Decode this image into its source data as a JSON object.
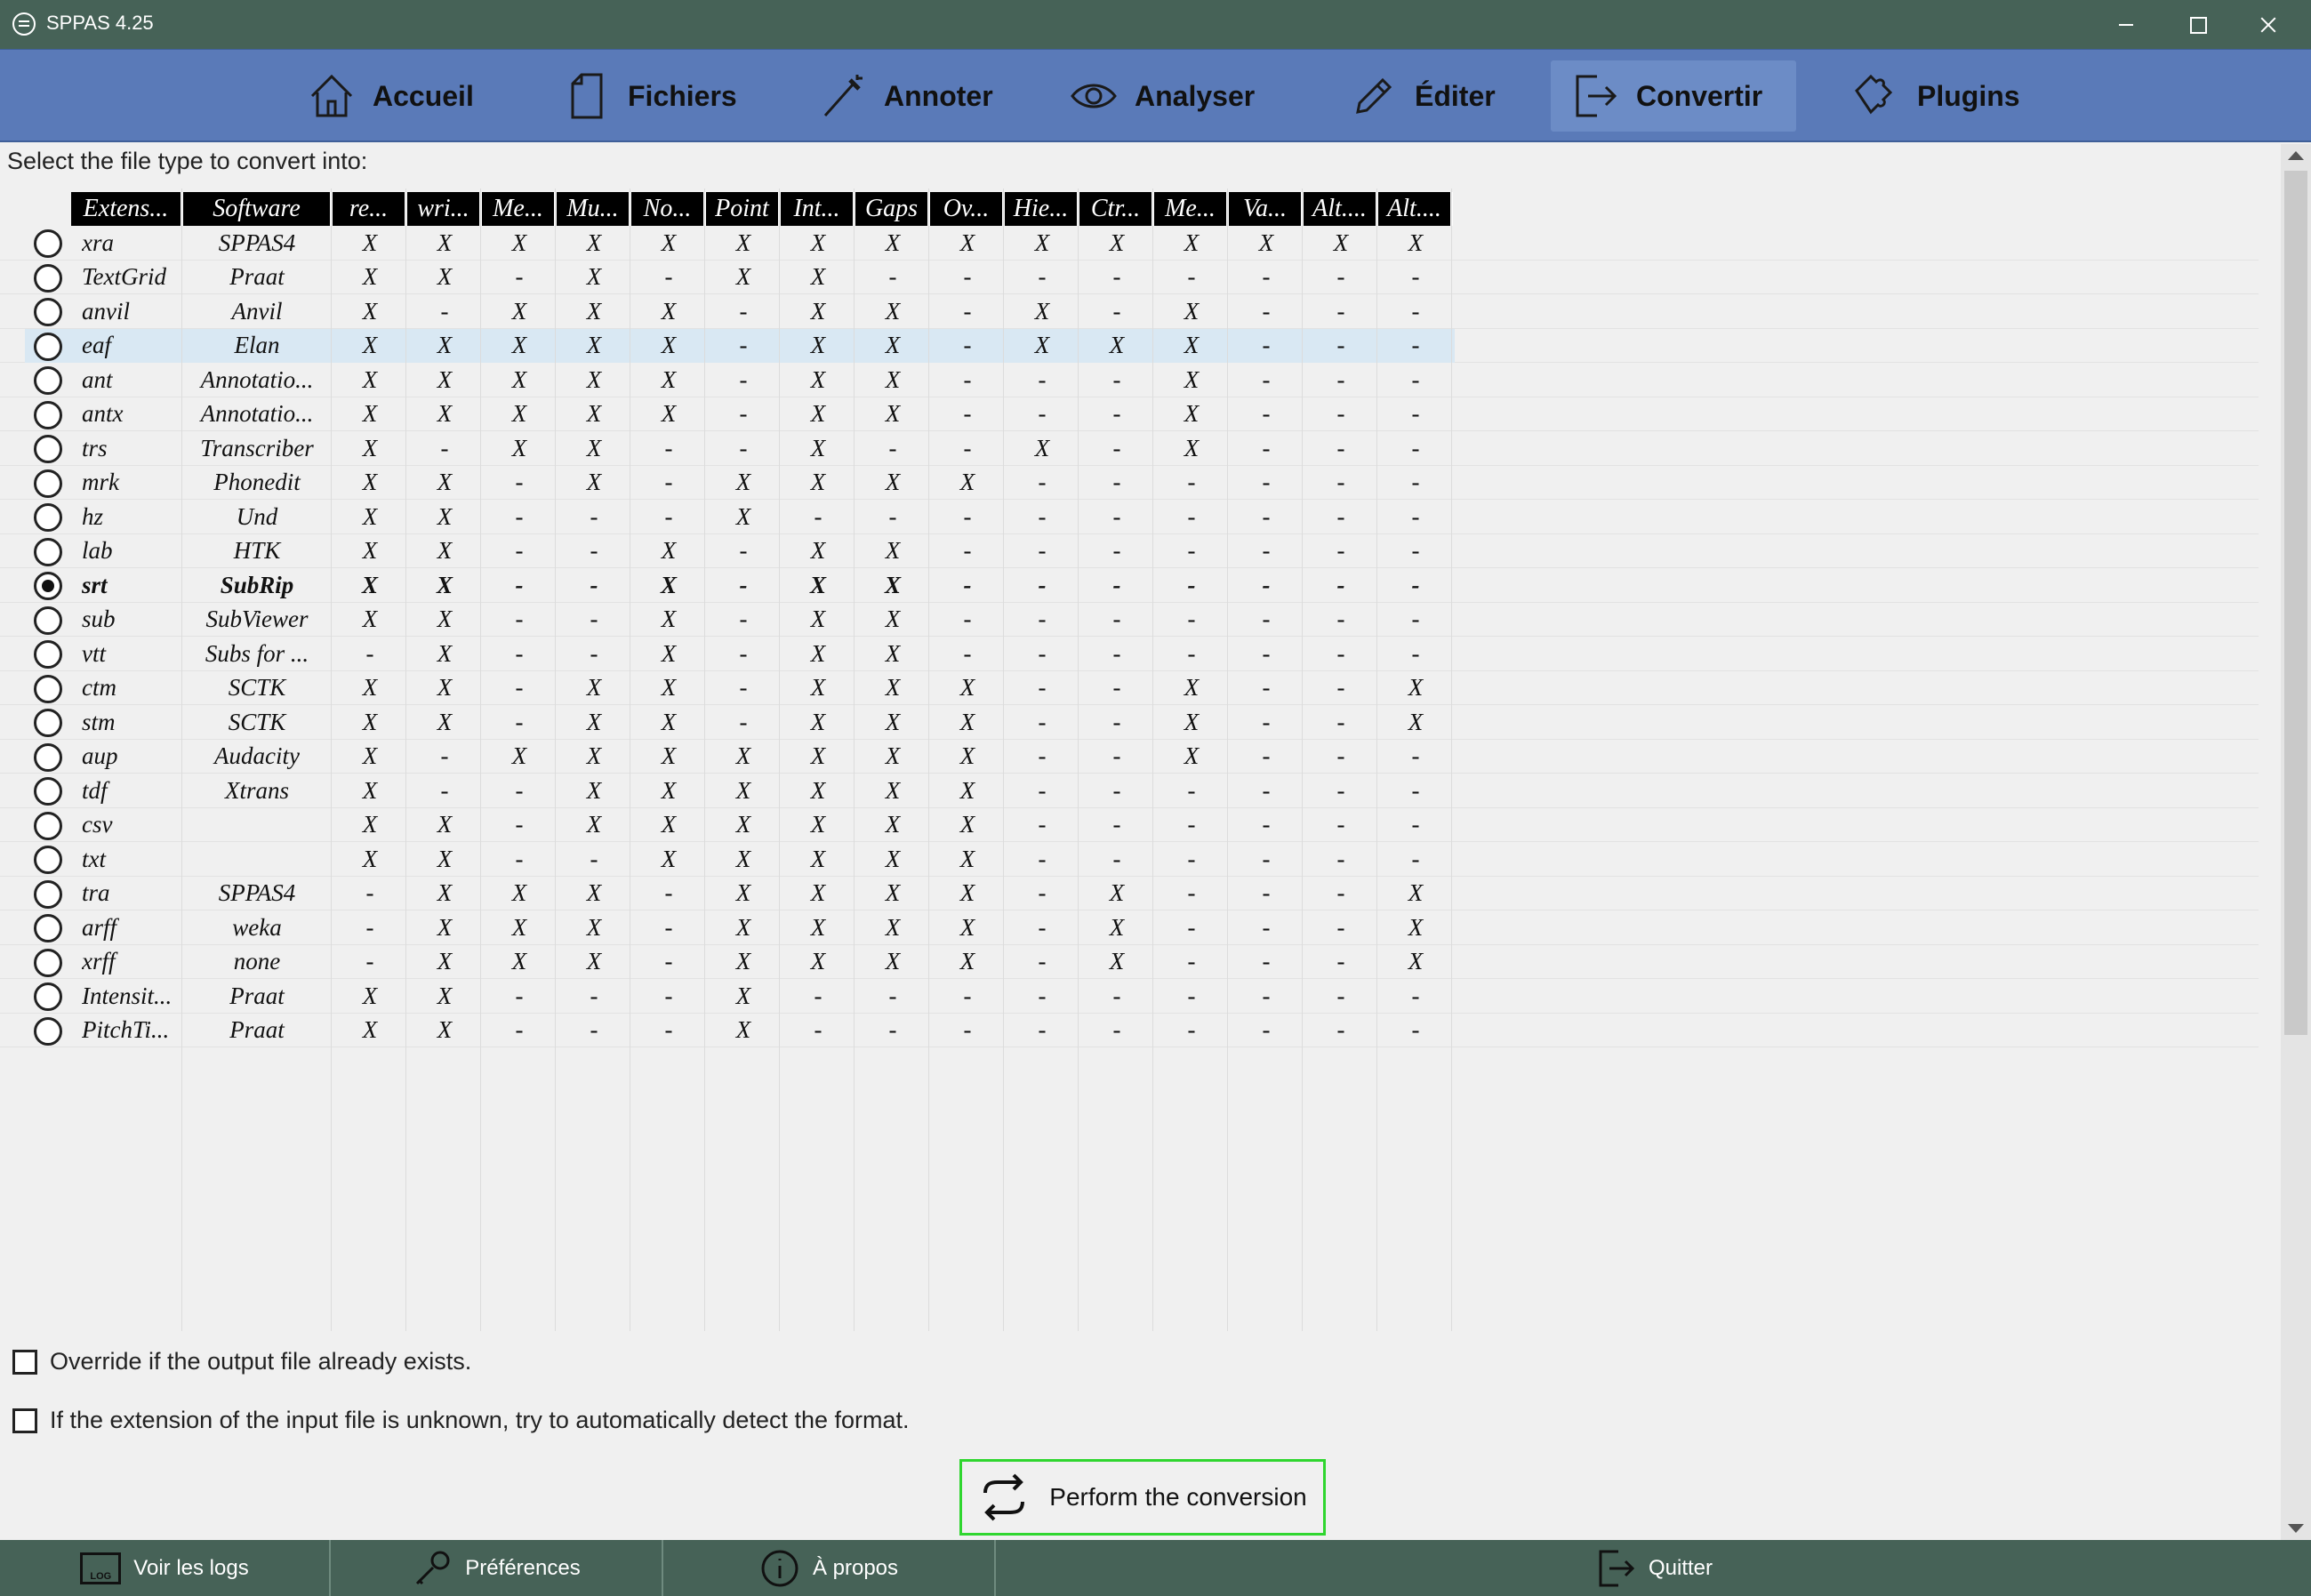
{
  "window": {
    "title": "SPPAS 4.25"
  },
  "nav": {
    "tabs": [
      {
        "label": "Accueil",
        "icon": "home-icon"
      },
      {
        "label": "Fichiers",
        "icon": "file-icon"
      },
      {
        "label": "Annoter",
        "icon": "wand-icon"
      },
      {
        "label": "Analyser",
        "icon": "eye-icon"
      },
      {
        "label": "Éditer",
        "icon": "pencil-icon"
      },
      {
        "label": "Convertir",
        "icon": "export-icon",
        "active": true
      },
      {
        "label": "Plugins",
        "icon": "puzzle-icon"
      }
    ]
  },
  "content": {
    "prompt": "Select the file type to convert into:"
  },
  "table": {
    "headers": [
      "Extens...",
      "Software",
      "re...",
      "wri...",
      "Me...",
      "Mu...",
      "No...",
      "Point",
      "Int...",
      "Gaps",
      "Ov...",
      "Hie...",
      "Ctr...",
      "Me...",
      "Va...",
      "Alt....",
      "Alt...."
    ],
    "selected_row": 10,
    "highlighted_row": 3,
    "rows": [
      {
        "ext": "xra",
        "software": "SPPAS4",
        "flags": [
          "X",
          "X",
          "X",
          "X",
          "X",
          "X",
          "X",
          "X",
          "X",
          "X",
          "X",
          "X",
          "X",
          "X",
          "X"
        ]
      },
      {
        "ext": "TextGrid",
        "software": "Praat",
        "flags": [
          "X",
          "X",
          "-",
          "X",
          "-",
          "X",
          "X",
          "-",
          "-",
          "-",
          "-",
          "-",
          "-",
          "-",
          "-"
        ]
      },
      {
        "ext": "anvil",
        "software": "Anvil",
        "flags": [
          "X",
          "-",
          "X",
          "X",
          "X",
          "-",
          "X",
          "X",
          "-",
          "X",
          "-",
          "X",
          "-",
          "-",
          "-"
        ]
      },
      {
        "ext": "eaf",
        "software": "Elan",
        "flags": [
          "X",
          "X",
          "X",
          "X",
          "X",
          "-",
          "X",
          "X",
          "-",
          "X",
          "X",
          "X",
          "-",
          "-",
          "-"
        ]
      },
      {
        "ext": "ant",
        "software": "Annotatio...",
        "flags": [
          "X",
          "X",
          "X",
          "X",
          "X",
          "-",
          "X",
          "X",
          "-",
          "-",
          "-",
          "X",
          "-",
          "-",
          "-"
        ]
      },
      {
        "ext": "antx",
        "software": "Annotatio...",
        "flags": [
          "X",
          "X",
          "X",
          "X",
          "X",
          "-",
          "X",
          "X",
          "-",
          "-",
          "-",
          "X",
          "-",
          "-",
          "-"
        ]
      },
      {
        "ext": "trs",
        "software": "Transcriber",
        "flags": [
          "X",
          "-",
          "X",
          "X",
          "-",
          "-",
          "X",
          "-",
          "-",
          "X",
          "-",
          "X",
          "-",
          "-",
          "-"
        ]
      },
      {
        "ext": "mrk",
        "software": "Phonedit",
        "flags": [
          "X",
          "X",
          "-",
          "X",
          "-",
          "X",
          "X",
          "X",
          "X",
          "-",
          "-",
          "-",
          "-",
          "-",
          "-"
        ]
      },
      {
        "ext": "hz",
        "software": "Und",
        "flags": [
          "X",
          "X",
          "-",
          "-",
          "-",
          "X",
          "-",
          "-",
          "-",
          "-",
          "-",
          "-",
          "-",
          "-",
          "-"
        ]
      },
      {
        "ext": "lab",
        "software": "HTK",
        "flags": [
          "X",
          "X",
          "-",
          "-",
          "X",
          "-",
          "X",
          "X",
          "-",
          "-",
          "-",
          "-",
          "-",
          "-",
          "-"
        ]
      },
      {
        "ext": "srt",
        "software": "SubRip",
        "flags": [
          "X",
          "X",
          "-",
          "-",
          "X",
          "-",
          "X",
          "X",
          "-",
          "-",
          "-",
          "-",
          "-",
          "-",
          "-"
        ]
      },
      {
        "ext": "sub",
        "software": "SubViewer",
        "flags": [
          "X",
          "X",
          "-",
          "-",
          "X",
          "-",
          "X",
          "X",
          "-",
          "-",
          "-",
          "-",
          "-",
          "-",
          "-"
        ]
      },
      {
        "ext": "vtt",
        "software": "Subs for ...",
        "flags": [
          "-",
          "X",
          "-",
          "-",
          "X",
          "-",
          "X",
          "X",
          "-",
          "-",
          "-",
          "-",
          "-",
          "-",
          "-"
        ]
      },
      {
        "ext": "ctm",
        "software": "SCTK",
        "flags": [
          "X",
          "X",
          "-",
          "X",
          "X",
          "-",
          "X",
          "X",
          "X",
          "-",
          "-",
          "X",
          "-",
          "-",
          "X"
        ]
      },
      {
        "ext": "stm",
        "software": "SCTK",
        "flags": [
          "X",
          "X",
          "-",
          "X",
          "X",
          "-",
          "X",
          "X",
          "X",
          "-",
          "-",
          "X",
          "-",
          "-",
          "X"
        ]
      },
      {
        "ext": "aup",
        "software": "Audacity",
        "flags": [
          "X",
          "-",
          "X",
          "X",
          "X",
          "X",
          "X",
          "X",
          "X",
          "-",
          "-",
          "X",
          "-",
          "-",
          "-"
        ]
      },
      {
        "ext": "tdf",
        "software": "Xtrans",
        "flags": [
          "X",
          "-",
          "-",
          "X",
          "X",
          "X",
          "X",
          "X",
          "X",
          "-",
          "-",
          "-",
          "-",
          "-",
          "-"
        ]
      },
      {
        "ext": "csv",
        "software": "",
        "flags": [
          "X",
          "X",
          "-",
          "X",
          "X",
          "X",
          "X",
          "X",
          "X",
          "-",
          "-",
          "-",
          "-",
          "-",
          "-"
        ]
      },
      {
        "ext": "txt",
        "software": "",
        "flags": [
          "X",
          "X",
          "-",
          "-",
          "X",
          "X",
          "X",
          "X",
          "X",
          "-",
          "-",
          "-",
          "-",
          "-",
          "-"
        ]
      },
      {
        "ext": "tra",
        "software": "SPPAS4",
        "flags": [
          "-",
          "X",
          "X",
          "X",
          "-",
          "X",
          "X",
          "X",
          "X",
          "-",
          "X",
          "-",
          "-",
          "-",
          "X"
        ]
      },
      {
        "ext": "arff",
        "software": "weka",
        "flags": [
          "-",
          "X",
          "X",
          "X",
          "-",
          "X",
          "X",
          "X",
          "X",
          "-",
          "X",
          "-",
          "-",
          "-",
          "X"
        ]
      },
      {
        "ext": "xrff",
        "software": "none",
        "flags": [
          "-",
          "X",
          "X",
          "X",
          "-",
          "X",
          "X",
          "X",
          "X",
          "-",
          "X",
          "-",
          "-",
          "-",
          "X"
        ]
      },
      {
        "ext": "Intensit...",
        "software": "Praat",
        "flags": [
          "X",
          "X",
          "-",
          "-",
          "-",
          "X",
          "-",
          "-",
          "-",
          "-",
          "-",
          "-",
          "-",
          "-",
          "-"
        ]
      },
      {
        "ext": "PitchTi...",
        "software": "Praat",
        "flags": [
          "X",
          "X",
          "-",
          "-",
          "-",
          "X",
          "-",
          "-",
          "-",
          "-",
          "-",
          "-",
          "-",
          "-",
          "-"
        ]
      }
    ]
  },
  "options": {
    "override_label": "Override if the output file already exists.",
    "override_checked": false,
    "autodetect_label": "If the extension of the input file is unknown, try to automatically detect the format.",
    "autodetect_checked": false
  },
  "actions": {
    "convert_label": "Perform the conversion"
  },
  "footer": {
    "logs_label": "Voir les logs",
    "logs_icon_text": "LOG",
    "prefs_label": "Préférences",
    "about_label": "À propos",
    "quit_label": "Quitter"
  },
  "colors": {
    "titlebar": "#466257",
    "navbar": "#5a7ab8",
    "nav_active": "#6c8cc6",
    "row_highlight": "#d9e8f3",
    "convert_border": "#2fd62f"
  }
}
